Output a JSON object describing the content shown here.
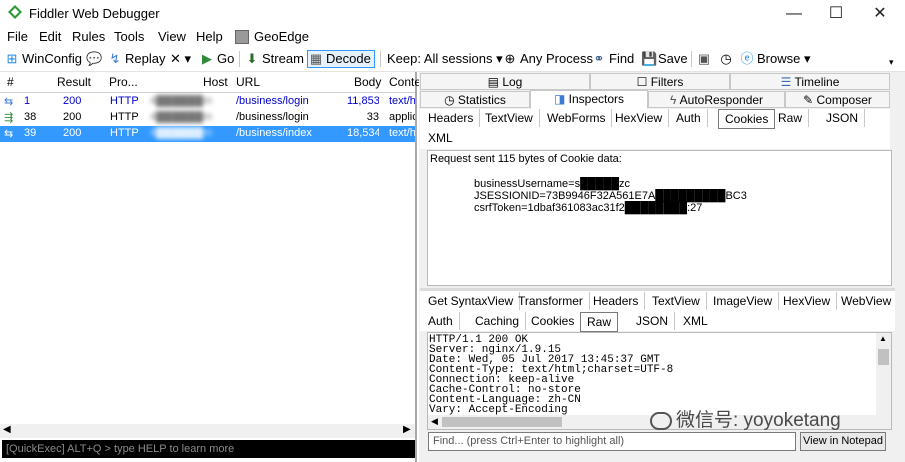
{
  "window": {
    "title": "Fiddler Web Debugger",
    "minimize": "—",
    "maximize": "☐",
    "close": "✕"
  },
  "menu": [
    "File",
    "Edit",
    "Rules",
    "Tools",
    "View",
    "Help",
    "GeoEdge"
  ],
  "toolbar": {
    "winconfig": "WinConfig",
    "replay": "Replay",
    "remove": "✕ ▾",
    "go": "Go",
    "stream": "Stream",
    "decode": "Decode",
    "keep": "Keep: All sessions ▾",
    "process": "Any Process",
    "find": "Find",
    "save": "Save",
    "browse": "Browse ▾"
  },
  "sessions": {
    "columns": [
      "#",
      "Result",
      "Pro...",
      "Host",
      "URL",
      "Body",
      "Conte"
    ],
    "rows": [
      {
        "num": "1",
        "result": "200",
        "protocol": "HTTP",
        "host": "4██████m",
        "url": "/business/login",
        "body": "11,853",
        "content": "text/h",
        "selected": false
      },
      {
        "num": "38",
        "result": "200",
        "protocol": "HTTP",
        "host": "4██████m",
        "url": "/business/login",
        "body": "33",
        "content": "applica",
        "selected": false
      },
      {
        "num": "39",
        "result": "200",
        "protocol": "HTTP",
        "host": "4██████m",
        "url": "/business/index",
        "body": "18,534",
        "content": "text/h",
        "selected": true
      }
    ]
  },
  "quickexec": "[QuickExec] ALT+Q > type HELP to learn more",
  "top_tabs_row1": [
    "Log",
    "Filters",
    "Timeline"
  ],
  "top_tabs_row2": [
    "Statistics",
    "Inspectors",
    "AutoResponder",
    "Composer"
  ],
  "request_tabs": [
    "Headers",
    "TextView",
    "WebForms",
    "HexView",
    "Auth",
    "Cookies",
    "Raw",
    "JSON",
    "XML"
  ],
  "request_content": {
    "line1": "Request sent 115 bytes of Cookie data:",
    "cookies": [
      "businessUsername=s█████zc",
      "JSESSIONID=73B9946F32A561E7A█████████BC3",
      "csrfToken=1dbaf361083ac31f2████████:27"
    ]
  },
  "response_tabs_row1": [
    "Get SyntaxView",
    "Transformer",
    "Headers",
    "TextView",
    "ImageView",
    "HexView",
    "WebView"
  ],
  "response_tabs_row2": [
    "Auth",
    "Caching",
    "Cookies",
    "Raw",
    "JSON",
    "XML"
  ],
  "response_raw": [
    "HTTP/1.1 200 OK",
    "Server: nginx/1.9.15",
    "Date: Wed, 05 Jul 2017 13:45:37 GMT",
    "Content-Type: text/html;charset=UTF-8",
    "Connection: keep-alive",
    "Cache-Control: no-store",
    "Content-Language: zh-CN",
    "Vary: Accept-Encoding"
  ],
  "find_placeholder": "Find... (press Ctrl+Enter to highlight all)",
  "view_notepad": "View in Notepad",
  "watermark": "微信号: yoyoketang",
  "colors": {
    "selection": "#3399ff",
    "link_blue": "#0000cc",
    "quickexec_bg": "#000000"
  }
}
